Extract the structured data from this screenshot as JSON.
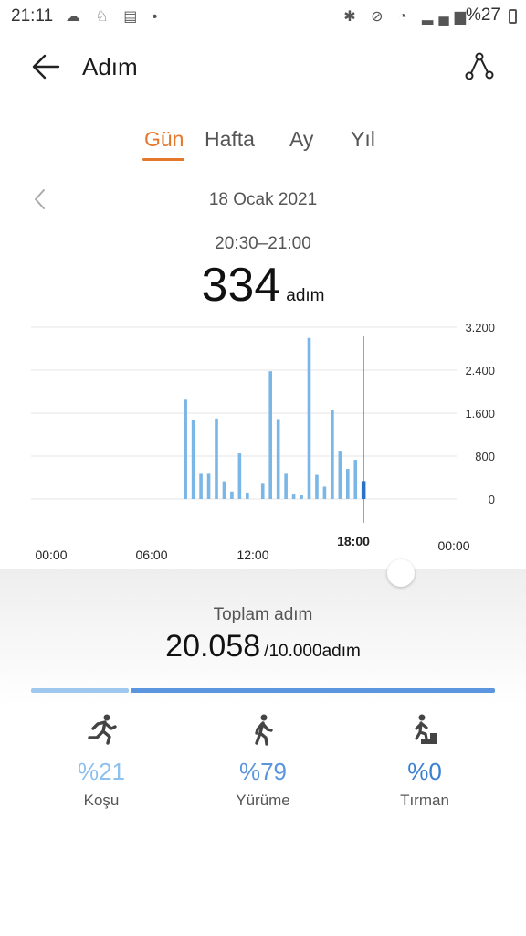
{
  "status_bar": {
    "time": "21:11",
    "left_icons": "☁ ♘ ▤ •",
    "right_icons": "✱ ⊘ ◔ ▂▄▆",
    "battery": "%27"
  },
  "header": {
    "title": "Adım",
    "back_icon": "arrow-left-icon",
    "route_icon": "route-icon"
  },
  "tabs": [
    {
      "label": "Gün",
      "active": true
    },
    {
      "label": "Hafta",
      "active": false
    },
    {
      "label": "Ay",
      "active": false
    },
    {
      "label": "Yıl",
      "active": false
    }
  ],
  "date": "18 Ocak 2021",
  "selection": {
    "range": "20:30–21:00",
    "steps": "334",
    "unit": "adım"
  },
  "chart_data": {
    "type": "bar",
    "y_ticks": [
      "3.200",
      "2.400",
      "1.600",
      "800",
      "0"
    ],
    "ylim": [
      0,
      3200
    ],
    "x_ticks": [
      "00:00",
      "06:00",
      "12:00",
      "18:00",
      "00:00"
    ],
    "x_unit": "hour",
    "xlim": [
      0,
      24
    ],
    "bar_color": "#7ab6e6",
    "selected_color": "#2a72c9",
    "bars": [
      {
        "t": 10.0,
        "v": 1850
      },
      {
        "t": 10.5,
        "v": 1480
      },
      {
        "t": 11.0,
        "v": 470
      },
      {
        "t": 11.5,
        "v": 470
      },
      {
        "t": 12.0,
        "v": 1500
      },
      {
        "t": 12.5,
        "v": 330
      },
      {
        "t": 13.0,
        "v": 140
      },
      {
        "t": 13.5,
        "v": 850
      },
      {
        "t": 14.0,
        "v": 120
      },
      {
        "t": 15.0,
        "v": 300
      },
      {
        "t": 15.5,
        "v": 2380
      },
      {
        "t": 16.0,
        "v": 1490
      },
      {
        "t": 16.5,
        "v": 470
      },
      {
        "t": 17.0,
        "v": 100
      },
      {
        "t": 17.5,
        "v": 80
      },
      {
        "t": 18.0,
        "v": 3000
      },
      {
        "t": 18.5,
        "v": 450
      },
      {
        "t": 19.0,
        "v": 230
      },
      {
        "t": 19.5,
        "v": 1660
      },
      {
        "t": 20.0,
        "v": 900
      },
      {
        "t": 20.5,
        "v": 560
      },
      {
        "t": 21.0,
        "v": 730
      },
      {
        "t": 21.5,
        "v": 334,
        "selected": true
      }
    ]
  },
  "summary": {
    "label": "Toplam adım",
    "total": "20.058",
    "goal": "/10.000adım",
    "running_fraction": 0.21,
    "walking_fraction": 0.79
  },
  "activities": [
    {
      "icon": "running-icon",
      "percent": "%21",
      "label": "Koşu",
      "color": "#8ec0ef"
    },
    {
      "icon": "walking-icon",
      "percent": "%79",
      "label": "Yürüme",
      "color": "#5a95dd"
    },
    {
      "icon": "climbing-icon",
      "percent": "%0",
      "label": "Tırman",
      "color": "#3a7fd1"
    }
  ]
}
